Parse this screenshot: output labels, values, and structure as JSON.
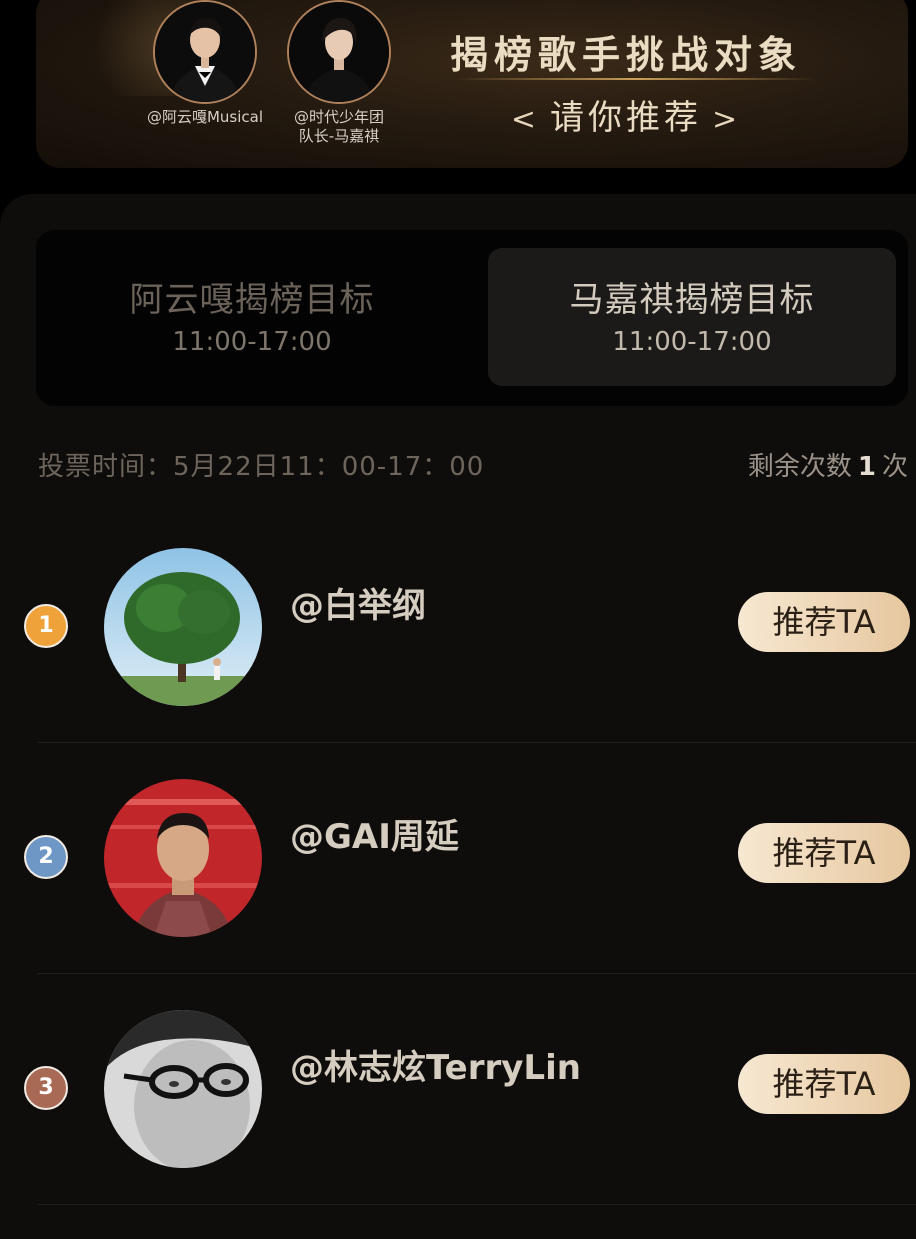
{
  "banner": {
    "singers": [
      {
        "tag_lines": [
          "@阿云嘎Musical"
        ]
      },
      {
        "tag_lines": [
          "@时代少年团",
          "队长-马嘉祺"
        ]
      }
    ],
    "title": "揭榜歌手挑战对象",
    "subtitle_left": "<",
    "subtitle": "请你推荐",
    "subtitle_right": ">"
  },
  "tabs": [
    {
      "name": "阿云嘎揭榜目标",
      "time": "11:00-17:00",
      "active": false
    },
    {
      "name": "马嘉祺揭榜目标",
      "time": "11:00-17:00",
      "active": true
    }
  ],
  "vote": {
    "time_label": "投票时间：5月22日11：00-17：00",
    "remaining_prefix": "剩余次数",
    "remaining_count": "1",
    "remaining_suffix": "次"
  },
  "candidates": [
    {
      "rank": "1",
      "rank_color": "#f0a23a",
      "handle": "@白举纲",
      "button": "推荐TA"
    },
    {
      "rank": "2",
      "rank_color": "#6f97c6",
      "handle": "@GAI周延",
      "button": "推荐TA"
    },
    {
      "rank": "3",
      "rank_color": "#a86a55",
      "handle": "@林志炫TerryLin",
      "button": "推荐TA"
    }
  ]
}
